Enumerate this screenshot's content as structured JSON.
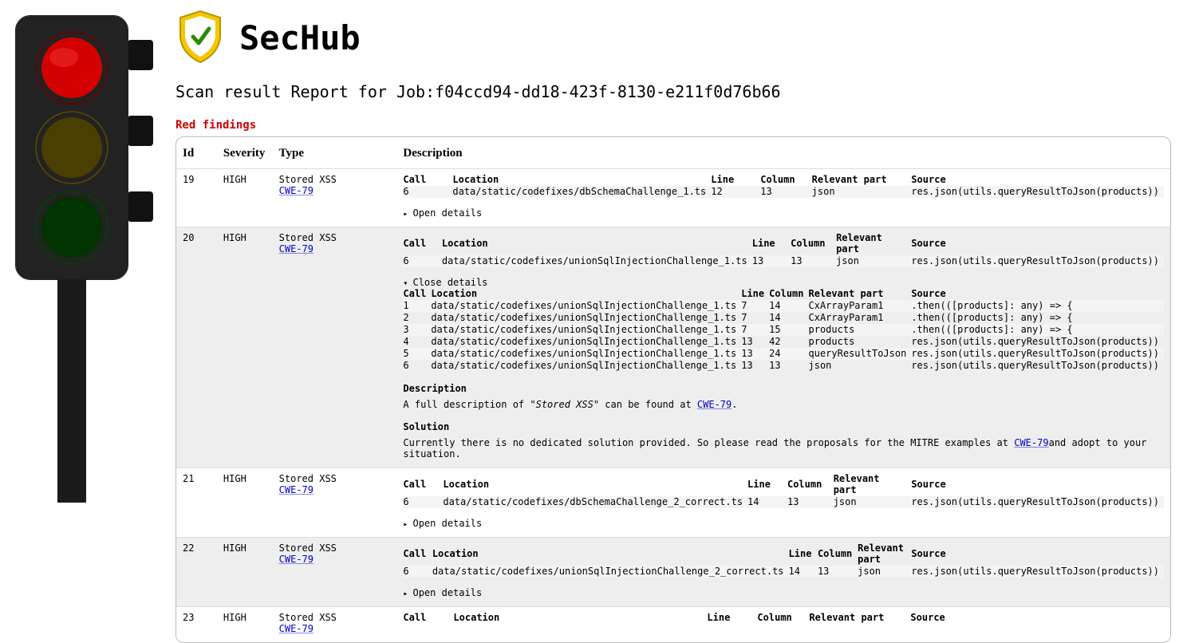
{
  "app": {
    "title": "SecHub",
    "report_label": "Scan result Report for Job:",
    "job_id": "f04ccd94-dd18-423f-8130-e211f0d76b66"
  },
  "section_title": "Red findings",
  "columns": {
    "id": "Id",
    "severity": "Severity",
    "type": "Type",
    "description": "Description"
  },
  "inner_columns": {
    "call": "Call",
    "location": "Location",
    "line": "Line",
    "column": "Column",
    "relevant": "Relevant part",
    "source": "Source"
  },
  "labels": {
    "open_details": "Open details",
    "close_details": "Close details",
    "description": "Description",
    "solution": "Solution",
    "full_desc_prefix": "A full description of \"",
    "full_desc_mid": "\" can be found at ",
    "full_desc_suffix": ".",
    "solution_text_prefix": "Currently there is no dedicated solution provided. So please read the proposals for the MITRE examples at ",
    "solution_text_suffix": "and adopt to your situation."
  },
  "findings": [
    {
      "id": "19",
      "severity": "HIGH",
      "type": "Stored XSS",
      "cwe": "CWE-79",
      "expanded": false,
      "summary": [
        {
          "call": "6",
          "location": "data/static/codefixes/dbSchemaChallenge_1.ts",
          "line": "12",
          "column": "13",
          "relevant": "json",
          "source": "res.json(utils.queryResultToJson(products))"
        }
      ]
    },
    {
      "id": "20",
      "severity": "HIGH",
      "type": "Stored XSS",
      "cwe": "CWE-79",
      "expanded": true,
      "summary": [
        {
          "call": "6",
          "location": "data/static/codefixes/unionSqlInjectionChallenge_1.ts",
          "line": "13",
          "column": "13",
          "relevant": "json",
          "source": "res.json(utils.queryResultToJson(products))"
        }
      ],
      "details_rows": [
        {
          "call": "1",
          "location": "data/static/codefixes/unionSqlInjectionChallenge_1.ts",
          "line": "7",
          "column": "14",
          "relevant": "CxArrayParam1",
          "source": ".then(([products]: any) => {"
        },
        {
          "call": "2",
          "location": "data/static/codefixes/unionSqlInjectionChallenge_1.ts",
          "line": "7",
          "column": "14",
          "relevant": "CxArrayParam1",
          "source": ".then(([products]: any) => {"
        },
        {
          "call": "3",
          "location": "data/static/codefixes/unionSqlInjectionChallenge_1.ts",
          "line": "7",
          "column": "15",
          "relevant": "products",
          "source": ".then(([products]: any) => {"
        },
        {
          "call": "4",
          "location": "data/static/codefixes/unionSqlInjectionChallenge_1.ts",
          "line": "13",
          "column": "42",
          "relevant": "products",
          "source": "res.json(utils.queryResultToJson(products))"
        },
        {
          "call": "5",
          "location": "data/static/codefixes/unionSqlInjectionChallenge_1.ts",
          "line": "13",
          "column": "24",
          "relevant": "queryResultToJson",
          "source": "res.json(utils.queryResultToJson(products))"
        },
        {
          "call": "6",
          "location": "data/static/codefixes/unionSqlInjectionChallenge_1.ts",
          "line": "13",
          "column": "13",
          "relevant": "json",
          "source": "res.json(utils.queryResultToJson(products))"
        }
      ]
    },
    {
      "id": "21",
      "severity": "HIGH",
      "type": "Stored XSS",
      "cwe": "CWE-79",
      "expanded": false,
      "summary": [
        {
          "call": "6",
          "location": "data/static/codefixes/dbSchemaChallenge_2_correct.ts",
          "line": "14",
          "column": "13",
          "relevant": "json",
          "source": "res.json(utils.queryResultToJson(products))"
        }
      ]
    },
    {
      "id": "22",
      "severity": "HIGH",
      "type": "Stored XSS",
      "cwe": "CWE-79",
      "expanded": false,
      "summary": [
        {
          "call": "6",
          "location": "data/static/codefixes/unionSqlInjectionChallenge_2_correct.ts",
          "line": "14",
          "column": "13",
          "relevant": "json",
          "source": "res.json(utils.queryResultToJson(products))"
        }
      ]
    },
    {
      "id": "23",
      "severity": "HIGH",
      "type": "Stored XSS",
      "cwe": "CWE-79",
      "expanded": false,
      "summary": [
        {
          "call": "",
          "location": "",
          "line": "",
          "column": "",
          "relevant": "",
          "source": ""
        }
      ],
      "truncated": true
    }
  ]
}
